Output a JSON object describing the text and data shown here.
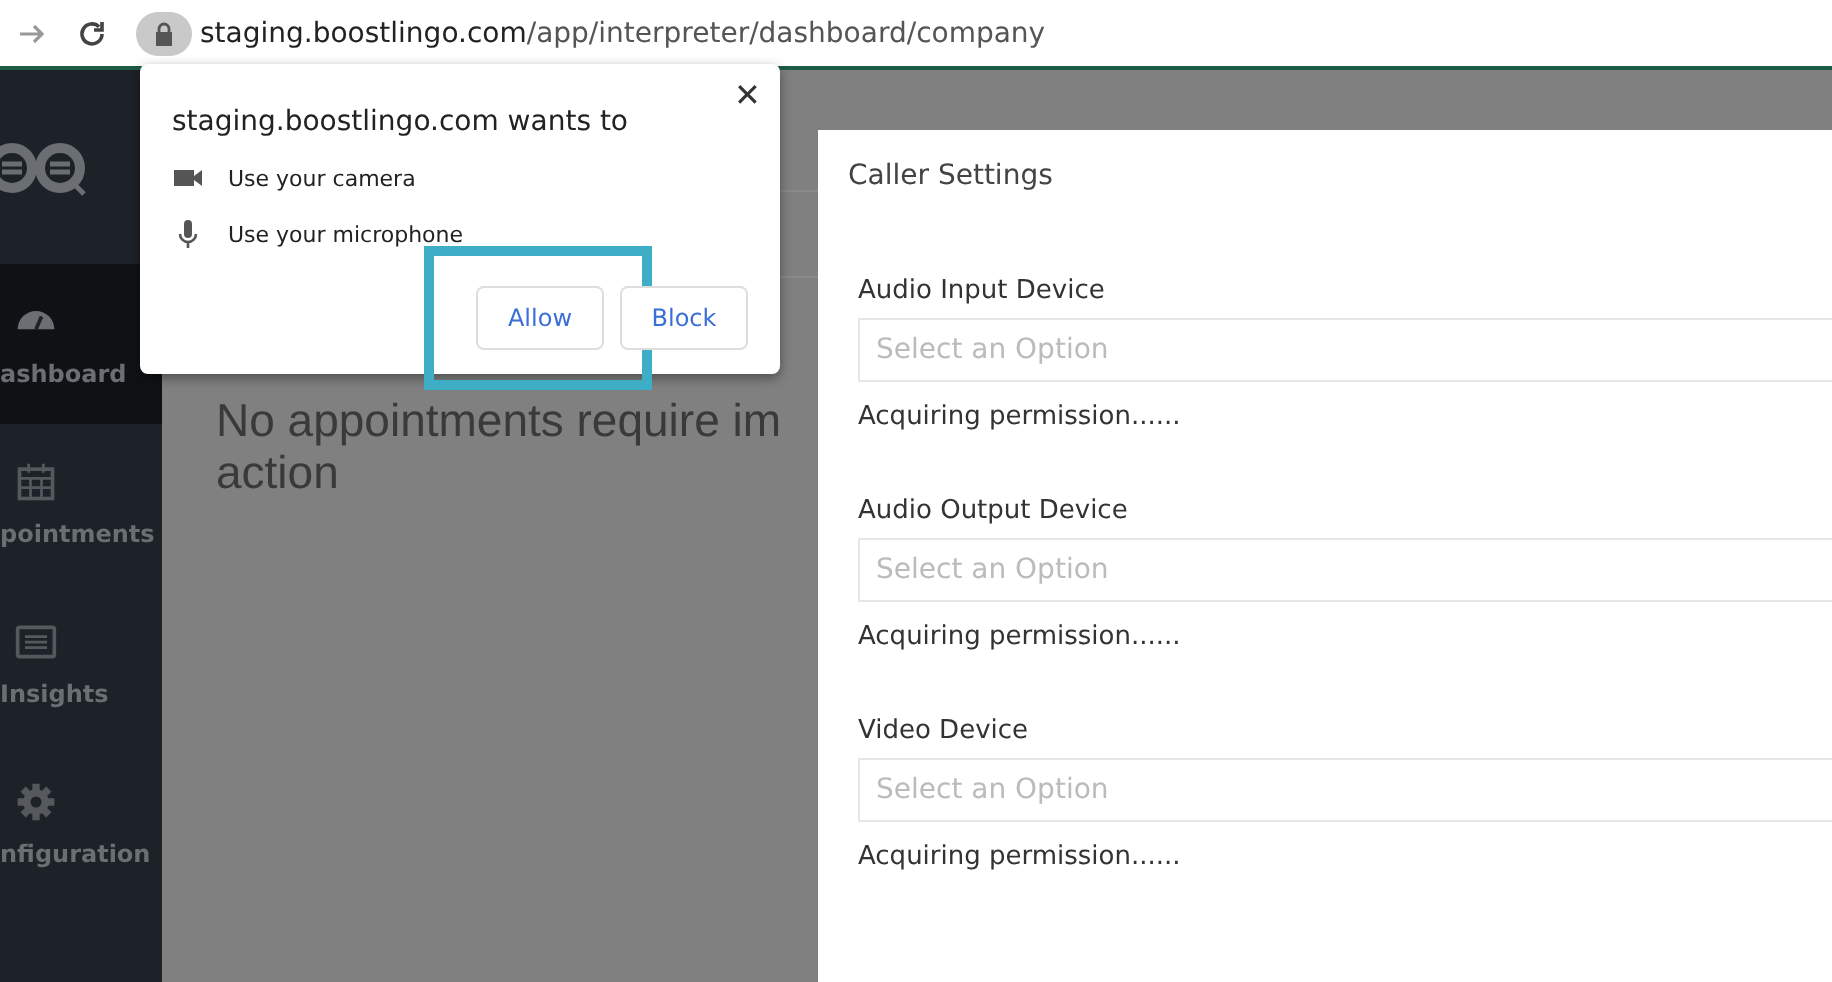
{
  "browser": {
    "url_host": "staging.boostlingo.com",
    "url_path": "/app/interpreter/dashboard/company"
  },
  "permission_popup": {
    "title": "staging.boostlingo.com wants to",
    "close": "✕",
    "permissions": [
      {
        "kind": "camera",
        "label": "Use your camera"
      },
      {
        "kind": "microphone",
        "label": "Use your microphone"
      }
    ],
    "buttons": [
      {
        "label": "Allow",
        "highlighted": true
      },
      {
        "label": "Block",
        "highlighted": false
      }
    ]
  },
  "sidebar": {
    "items": [
      {
        "label": "ashboard",
        "selected": true
      },
      {
        "label": "pointments",
        "selected": false
      },
      {
        "label": "Insights",
        "selected": false
      },
      {
        "label": "nfiguration",
        "selected": false
      }
    ]
  },
  "main": {
    "message_lines": [
      "No appointments require im",
      "action"
    ]
  },
  "caller_settings": {
    "title": "Caller Settings",
    "fields": [
      {
        "label": "Audio Input Device",
        "placeholder": "Select an Option",
        "status": "Acquiring permission......"
      },
      {
        "label": "Audio Output Device",
        "placeholder": "Select an Option",
        "status": "Acquiring permission......"
      },
      {
        "label": "Video Device",
        "placeholder": "Select an Option",
        "status": "Acquiring permission......"
      }
    ]
  }
}
